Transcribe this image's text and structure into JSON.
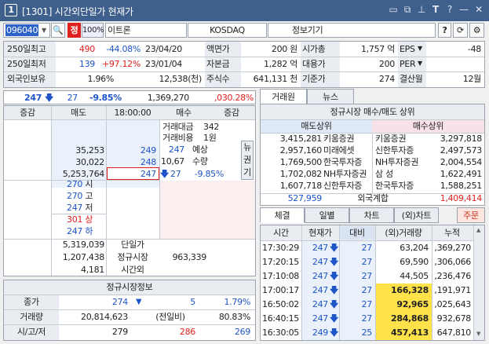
{
  "window": {
    "number": "1",
    "title": "[1301] 시간외단일가 현재가"
  },
  "toolbar": {
    "code": "096040",
    "name_tag": "정",
    "percent": "100%",
    "name": "이트론",
    "market": "KOSDAQ",
    "info_btn": "정보기기",
    "help": "?"
  },
  "summary": {
    "rows": [
      {
        "l1": "250일최고",
        "v1": "490",
        "p1": "-44.08%",
        "d1": "23/04/20",
        "l2": "액면가",
        "v2": "200 원",
        "l3": "시가총",
        "v3": "1,757 억",
        "l4": "EPS",
        "v4": "-48"
      },
      {
        "l1": "250일최저",
        "v1": "139",
        "p1": "+97.12%",
        "d1": "23/01/04",
        "l2": "자본금",
        "v2": "1,282 억",
        "l3": "대용가",
        "v3": "200",
        "l4": "PER",
        "v4": ""
      },
      {
        "l1": "외국인보유",
        "v1": "1.96%",
        "p1": "12,538(천)",
        "d1": "",
        "l2": "주식수",
        "v2": "641,131 천",
        "l3": "기준가",
        "v3": "274",
        "l4": "결산월",
        "v4": "12월"
      }
    ]
  },
  "price_bar": {
    "price": "247",
    "change": "27",
    "rate": "-9.85%",
    "volume": "1,369,270",
    "ratio": ",030.28%"
  },
  "orderbook": {
    "headers": [
      "증감",
      "매도",
      "18:00:00",
      "매수",
      "증감"
    ],
    "trade_amount_label": "거래대금",
    "trade_amount": "342",
    "trade_cost_label": "거래비용",
    "trade_cost": "1원",
    "asks": [
      {
        "qty": "35,253",
        "price": "249"
      },
      {
        "qty": "30,022",
        "price": "248"
      },
      {
        "qty": "5,253,764",
        "price": "247"
      }
    ],
    "expected_price": "247",
    "expected_label": "예상",
    "expected_qty": "10,676",
    "qty_label": "수량",
    "expected_change": "27",
    "expected_rate": "-9.85%",
    "side_tabs": [
      "뉴",
      "권",
      "기"
    ],
    "stats": [
      {
        "price": "270",
        "label": "시"
      },
      {
        "price": "270",
        "label": "고"
      },
      {
        "price": "247",
        "label": "저"
      },
      {
        "price": "301",
        "label": "상"
      },
      {
        "price": "247",
        "label": "하"
      }
    ],
    "bottom": [
      {
        "left": "5,319,039",
        "mid": "단일가",
        "right": ""
      },
      {
        "left": "1,207,438",
        "mid": "정규시장",
        "right": "963,339"
      },
      {
        "left": "4,181",
        "mid": "시간외",
        "right": ""
      }
    ]
  },
  "regular": {
    "title": "정규시장정보",
    "rows": [
      {
        "label": "종가",
        "a": "274",
        "b": "5",
        "c": "1.79%"
      },
      {
        "label": "거래량",
        "a": "20,814,623",
        "b": "(전일비)",
        "c": "80.83%"
      },
      {
        "label": "시/고/저",
        "a": "279",
        "b": "286",
        "c": "269"
      }
    ]
  },
  "broker": {
    "tabs": [
      "거래원",
      "뉴스"
    ],
    "title": "정규시장 매수/매도 상위",
    "sell_header": "매도상위",
    "buy_header": "매수상위",
    "rows": [
      {
        "sq": "3,415,281",
        "sn": "키움증권",
        "bn": "키움증권",
        "bq": "3,297,818"
      },
      {
        "sq": "2,957,160",
        "sn": "미래에셋",
        "bn": "신한투자증",
        "bq": "2,497,573"
      },
      {
        "sq": "1,769,500",
        "sn": "한국투자증",
        "bn": "NH투자증권",
        "bq": "2,004,554"
      },
      {
        "sq": "1,702,082",
        "sn": "NH투자증권",
        "bn": "삼  성",
        "bq": "1,622,491"
      },
      {
        "sq": "1,607,718",
        "sn": "신한투자증",
        "bn": "한국투자증",
        "bq": "1,588,251"
      }
    ],
    "foreign_sell": "527,959",
    "foreign_label": "외국계합",
    "foreign_buy": "1,409,414"
  },
  "trades": {
    "tabs": [
      "체결",
      "일별",
      "차트",
      "(외)차트",
      "주문"
    ],
    "headers": [
      "시간",
      "현재가",
      "대비",
      "(외)거래량",
      "누적"
    ],
    "rows": [
      {
        "t": "17:30:29",
        "p": "247",
        "d": "27",
        "v": "63,204",
        "a": ",369,270",
        "hl": false
      },
      {
        "t": "17:20:15",
        "p": "247",
        "d": "27",
        "v": "69,590",
        "a": ",306,066",
        "hl": false
      },
      {
        "t": "17:10:08",
        "p": "247",
        "d": "27",
        "v": "44,505",
        "a": ",236,476",
        "hl": false
      },
      {
        "t": "17:00:17",
        "p": "247",
        "d": "27",
        "v": "166,328",
        "a": ",191,971",
        "hl": true
      },
      {
        "t": "16:50:02",
        "p": "247",
        "d": "27",
        "v": "92,965",
        "a": ",025,643",
        "hl": true
      },
      {
        "t": "16:40:15",
        "p": "247",
        "d": "27",
        "v": "284,868",
        "a": "932,678",
        "hl": true
      },
      {
        "t": "16:30:05",
        "p": "249",
        "d": "25",
        "v": "457,413",
        "a": "647,810",
        "hl": true
      }
    ]
  },
  "colors": {
    "title_bar": "#3f5f8c",
    "up": "#e0201e",
    "down": "#1d54c8",
    "highlight": "#ffe14a"
  }
}
